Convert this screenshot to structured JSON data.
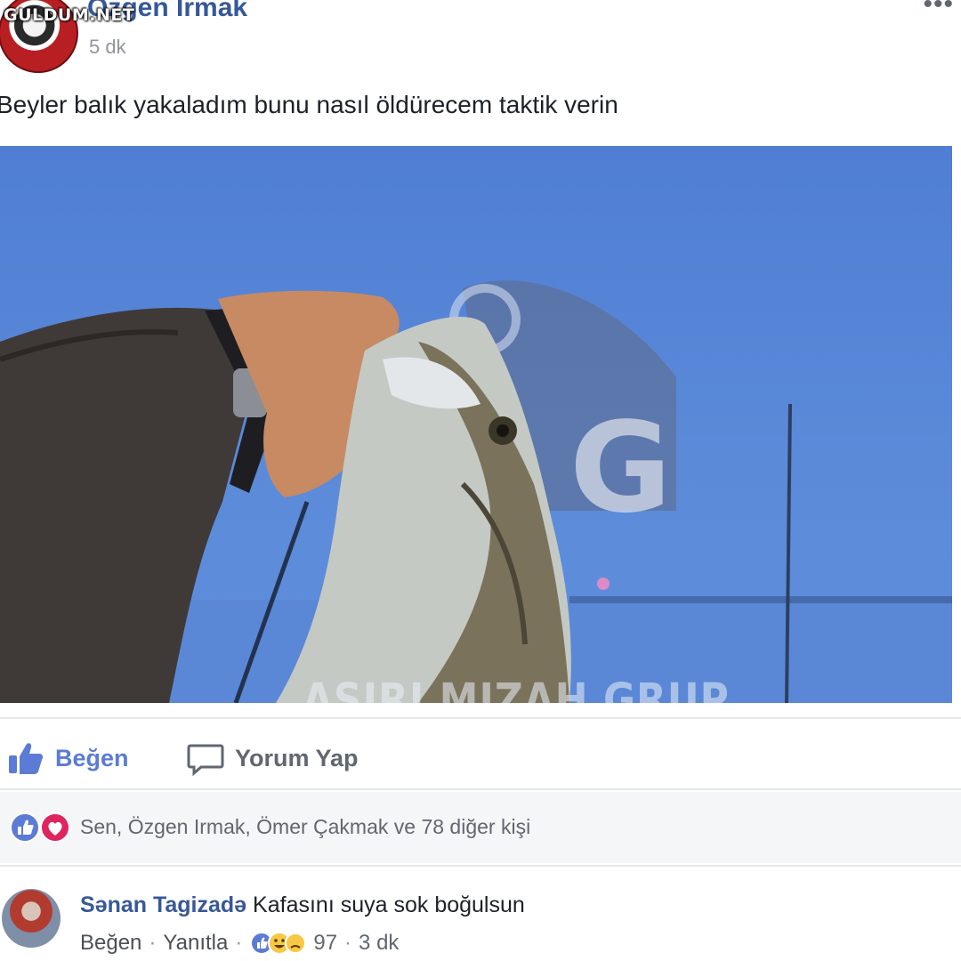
{
  "site_watermark": "GULDUM.NET",
  "post": {
    "author": "Özgen Irmak",
    "time": "5 dk",
    "text": "Beyler balık yakaladım bunu nasıl öldürecem taktik verin",
    "image_watermark": "AŞIRI MIZAH GRUP"
  },
  "actions": {
    "like_label": "Beğen",
    "comment_label": "Yorum Yap"
  },
  "reactions": {
    "summary": "Sen, Özgen Irmak, Ömer Çakmak ve 78 diğer kişi",
    "icons": [
      "like-icon",
      "love-icon"
    ]
  },
  "comment": {
    "author": "Sənan Tagizadə",
    "text": "Kafasını suya sok boğulsun",
    "like_label": "Beğen",
    "reply_label": "Yanıtla",
    "reaction_count": "97",
    "time": "3 dk"
  },
  "colors": {
    "link_blue": "#385898",
    "like_active": "#5b7bd5",
    "meta_gray": "#616770"
  }
}
